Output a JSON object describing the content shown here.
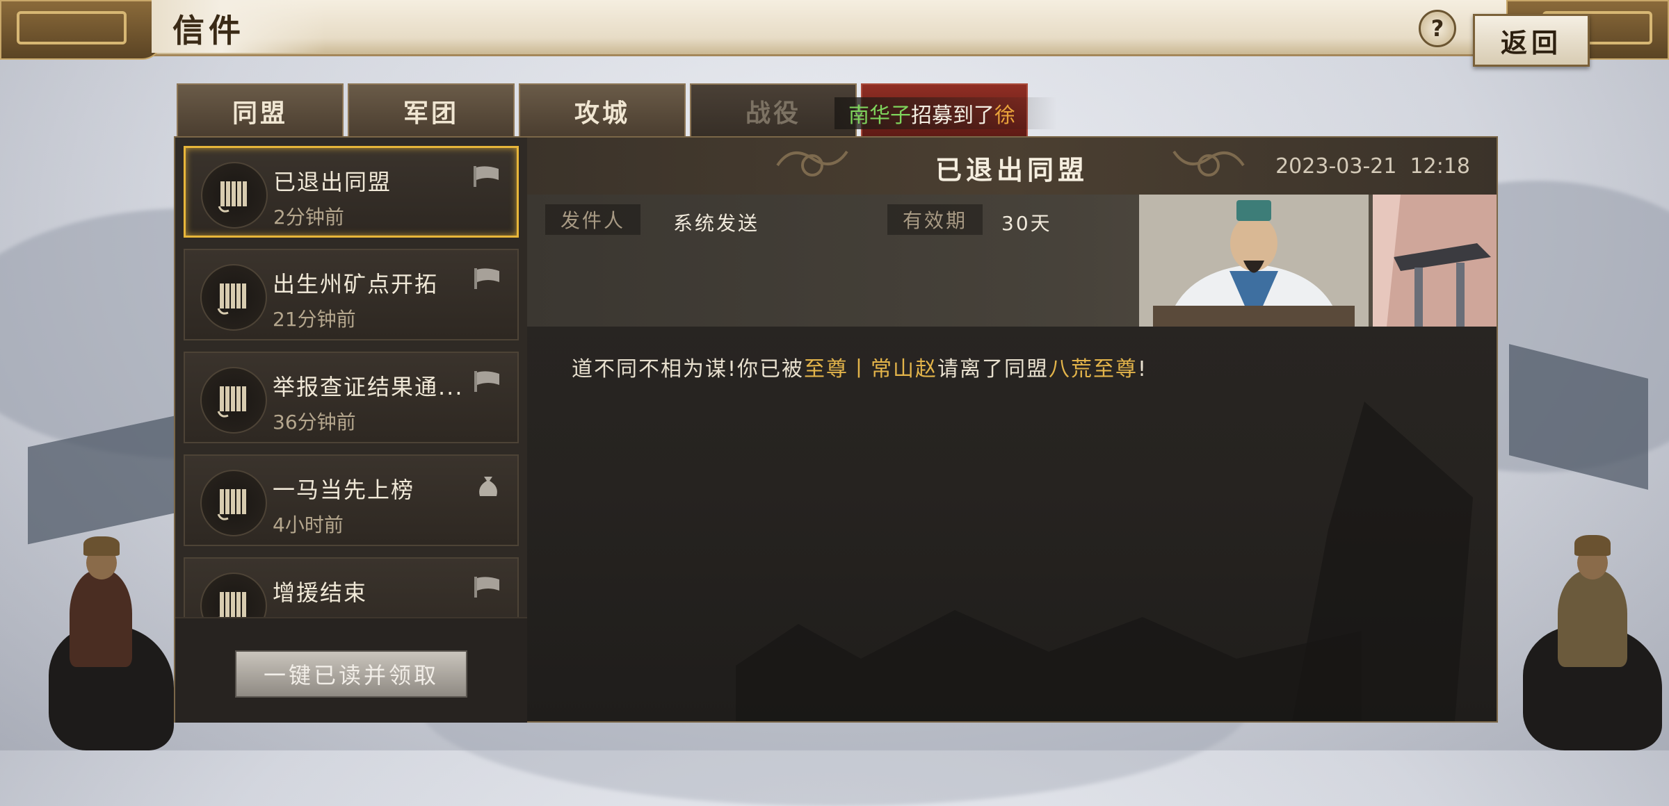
{
  "window": {
    "title": "信件"
  },
  "top_bar": {
    "help_label": "?",
    "back_label": "返回"
  },
  "tabs": [
    {
      "label": "同盟",
      "state": "active"
    },
    {
      "label": "军团",
      "state": "normal"
    },
    {
      "label": "攻城",
      "state": "normal"
    },
    {
      "label": "战役",
      "state": "disabled"
    },
    {
      "label": "",
      "state": "alert"
    }
  ],
  "ticker": {
    "part1": "南华子",
    "part2": "招募到了",
    "part3": "徐"
  },
  "mail_list": [
    {
      "title": "已退出同盟",
      "time": "2分钟前",
      "icon": "scroll-icon",
      "badge": "flag-icon",
      "selected": true
    },
    {
      "title": "出生州矿点开拓",
      "time": "21分钟前",
      "icon": "scroll-icon",
      "badge": "flag-icon",
      "selected": false
    },
    {
      "title": "举报查证结果通...",
      "time": "36分钟前",
      "icon": "scroll-icon",
      "badge": "flag-icon",
      "selected": false
    },
    {
      "title": "一马当先上榜",
      "time": "4小时前",
      "icon": "scroll-icon",
      "badge": "pouch-icon",
      "selected": false
    },
    {
      "title": "增援结束",
      "time": "",
      "icon": "scroll-icon",
      "badge": "flag-icon",
      "selected": false
    }
  ],
  "claim_all_label": "一键已读并领取",
  "detail": {
    "title": "已退出同盟",
    "date": "2023-03-21",
    "time": "12:18",
    "sender_label": "发件人",
    "sender_value": "系统发送",
    "validity_label": "有效期",
    "validity_value": "30天",
    "message": {
      "part1": "道不同不相为谋!你已被",
      "part2": "至尊丨常山赵",
      "part3": "请离了同盟",
      "part4": "八荒至尊",
      "part5": "!"
    }
  },
  "colors": {
    "accent_gold": "#e3b44a",
    "selected_border": "#e8b63a",
    "ticker_green": "#7fd45c"
  }
}
